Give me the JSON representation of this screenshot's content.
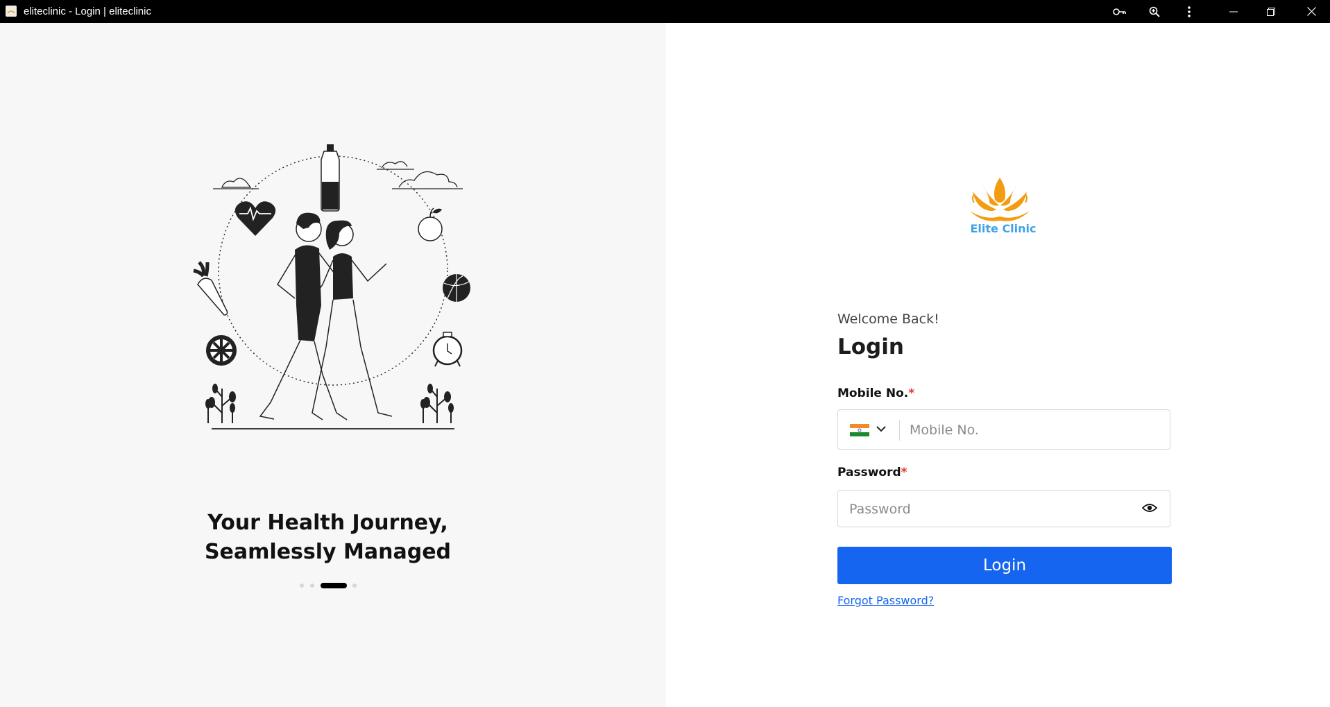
{
  "window": {
    "title": "eliteclinic - Login | eliteclinic",
    "icons": [
      "key-icon",
      "zoom-icon",
      "more-vertical-icon",
      "minimize-icon",
      "restore-icon",
      "close-icon"
    ]
  },
  "hero": {
    "headline_line1": "Your Health Journey,",
    "headline_line2": "Seamlessly Managed",
    "carousel": {
      "total": 4,
      "active_index": 2
    }
  },
  "brand": {
    "logo_text": "Elite Clinic",
    "logo_color": "#f39c12",
    "text_color": "#3fa2e8"
  },
  "form": {
    "welcome": "Welcome Back!",
    "title": "Login",
    "mobile_label": "Mobile No.",
    "mobile_placeholder": "Mobile No.",
    "mobile_value": "",
    "country_flag": "india-flag-icon",
    "password_label": "Password",
    "password_placeholder": "Password",
    "password_value": "",
    "required_mark": "*",
    "submit_label": "Login",
    "forgot_label": "Forgot Password?",
    "accent_color": "#1565f0"
  }
}
